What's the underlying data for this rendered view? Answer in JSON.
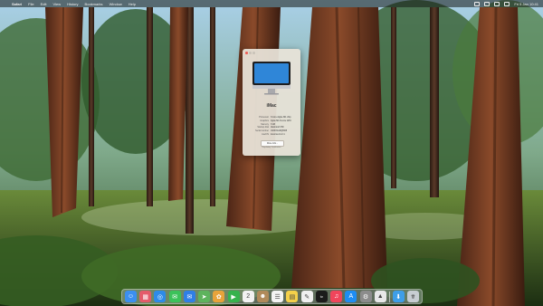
{
  "menubar": {
    "apple_glyph": "",
    "app_name": "Safari",
    "menus": [
      "File",
      "Edit",
      "View",
      "History",
      "Bookmarks",
      "Window",
      "Help"
    ],
    "clock": "Fri 5 Jan 10:41"
  },
  "about_window": {
    "title": "iMac",
    "specs": [
      {
        "key": "Processor",
        "value": "8-Core Apple M1 chip"
      },
      {
        "key": "Graphics",
        "value": "Apple M1 8-core GPU"
      },
      {
        "key": "Memory",
        "value": "8 GB"
      },
      {
        "key": "Startup disk",
        "value": "Macintosh HD"
      },
      {
        "key": "Serial number",
        "value": "C02FX1AZQ6W5"
      },
      {
        "key": "macOS",
        "value": "Sonoma 14.2.1"
      }
    ],
    "more_info_label": "More Info...",
    "regulatory": "Regulatory Certification"
  },
  "dock": {
    "apps": [
      {
        "name": "finder",
        "glyph": "☺",
        "color": "#3b8ff0"
      },
      {
        "name": "launchpad",
        "glyph": "▦",
        "color": "#e45b6a"
      },
      {
        "name": "safari",
        "glyph": "◎",
        "color": "#2d8be8"
      },
      {
        "name": "messages",
        "glyph": "✉",
        "color": "#3bc25a"
      },
      {
        "name": "mail",
        "glyph": "✉",
        "color": "#2f7fe6"
      },
      {
        "name": "maps",
        "glyph": "➤",
        "color": "#5db35d"
      },
      {
        "name": "photos",
        "glyph": "✿",
        "color": "#e8a33a"
      },
      {
        "name": "facetime",
        "glyph": "▶",
        "color": "#37b24d"
      },
      {
        "name": "calendar",
        "glyph": "2",
        "color": "#f2f2f2"
      },
      {
        "name": "contacts",
        "glyph": "☻",
        "color": "#b08a5a"
      },
      {
        "name": "reminders",
        "glyph": "☰",
        "color": "#f4f4f4"
      },
      {
        "name": "notes",
        "glyph": "▤",
        "color": "#f4d04a"
      },
      {
        "name": "freeform",
        "glyph": "✎",
        "color": "#f0f0f0"
      },
      {
        "name": "tv",
        "glyph": "tv",
        "color": "#1b1b1b"
      },
      {
        "name": "music",
        "glyph": "♫",
        "color": "#f0455b"
      },
      {
        "name": "app-store",
        "glyph": "A",
        "color": "#1e8df2"
      },
      {
        "name": "system-settings",
        "glyph": "⚙",
        "color": "#8c8c8c"
      },
      {
        "name": "preview",
        "glyph": "▲",
        "color": "#e8e8e8"
      }
    ],
    "trailing": [
      {
        "name": "downloads",
        "glyph": "⬇",
        "color": "#3e9ee8"
      },
      {
        "name": "trash",
        "glyph": "🗑",
        "color": "#c7cdd2"
      }
    ]
  },
  "colors": {
    "close_button": "#ed5f57",
    "dock_bg": "#aab4b4"
  }
}
